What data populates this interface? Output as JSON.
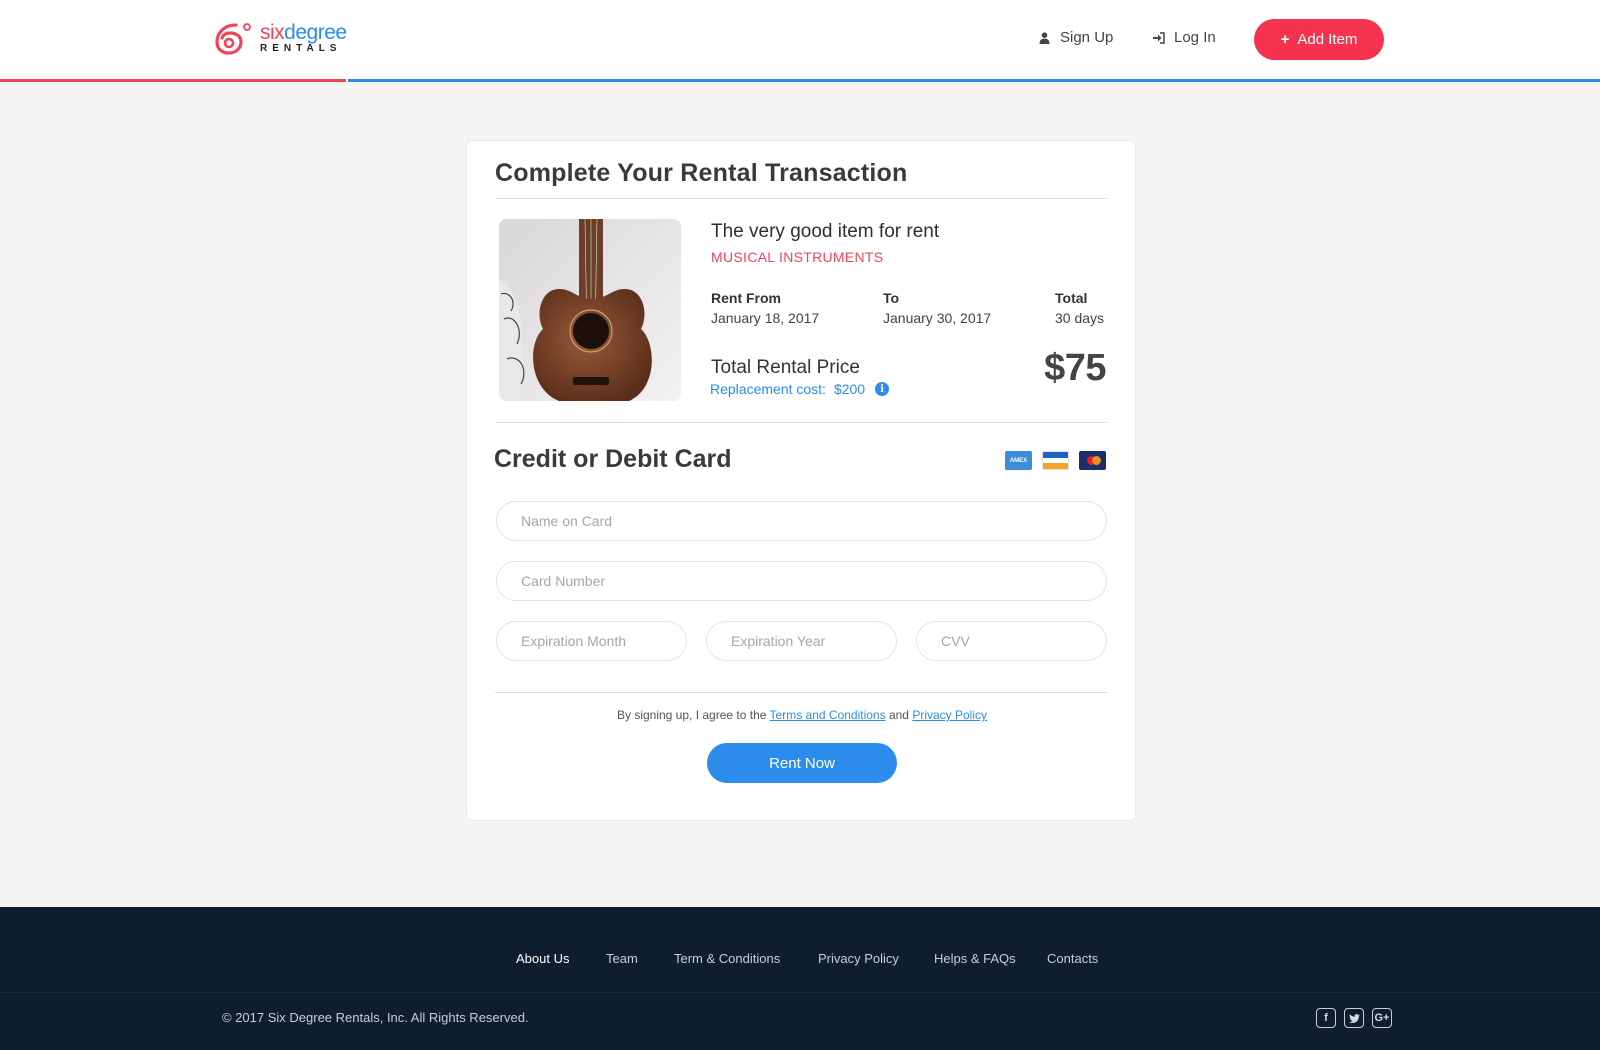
{
  "header": {
    "logo": {
      "word_six": "six",
      "word_degree": "degree",
      "sub": "RENTALS"
    },
    "nav": {
      "signup_label": "Sign Up",
      "login_label": "Log In",
      "add_item_label": "Add Item",
      "add_item_icon": "plus-icon"
    }
  },
  "transaction": {
    "title": "Complete Your Rental Transaction",
    "item": {
      "name": "The very good item for rent",
      "category": "MUSICAL INSTRUMENTS",
      "photo": "acoustic-guitar-image"
    },
    "columns": [
      {
        "label": "Rent From",
        "value": "January 18, 2017"
      },
      {
        "label": "To",
        "value": "January 30, 2017"
      },
      {
        "label": "Total",
        "value": "30 days"
      }
    ],
    "price_label": "Total Rental Price",
    "replacement_label": "Replacement cost:",
    "replacement_amount": "$200",
    "price": "$75"
  },
  "payment": {
    "title": "Credit or Debit Card",
    "card_icons": [
      "amex-card-icon",
      "visa-card-icon",
      "mastercard-icon"
    ],
    "amex_text": "AMEX",
    "fields": {
      "name_placeholder": "Name on Card",
      "number_placeholder": "Card Number",
      "month_placeholder": "Expiration Month",
      "year_placeholder": "Expiration Year",
      "cvv_placeholder": "CVV"
    },
    "terms_prefix": "By signing up, I agree to the",
    "terms_link": "Terms and Conditions",
    "terms_and": "and",
    "privacy_link": "Privacy Policy",
    "rent_button": "Rent Now"
  },
  "footer": {
    "links": [
      "About Us",
      "Team",
      "Term & Conditions",
      "Privacy Policy",
      "Helps & FAQs",
      "Contacts"
    ],
    "copyright": "© 2017  Six Degree Rentals, Inc. All Rights Reserved.",
    "social": [
      "facebook-icon",
      "twitter-icon",
      "google-plus-icon"
    ]
  },
  "colors": {
    "brand_red": "#f6334f",
    "brand_blue": "#2b8ceb",
    "footer_bg": "#0f1e2d",
    "page_bg": "#f6f5f3"
  }
}
